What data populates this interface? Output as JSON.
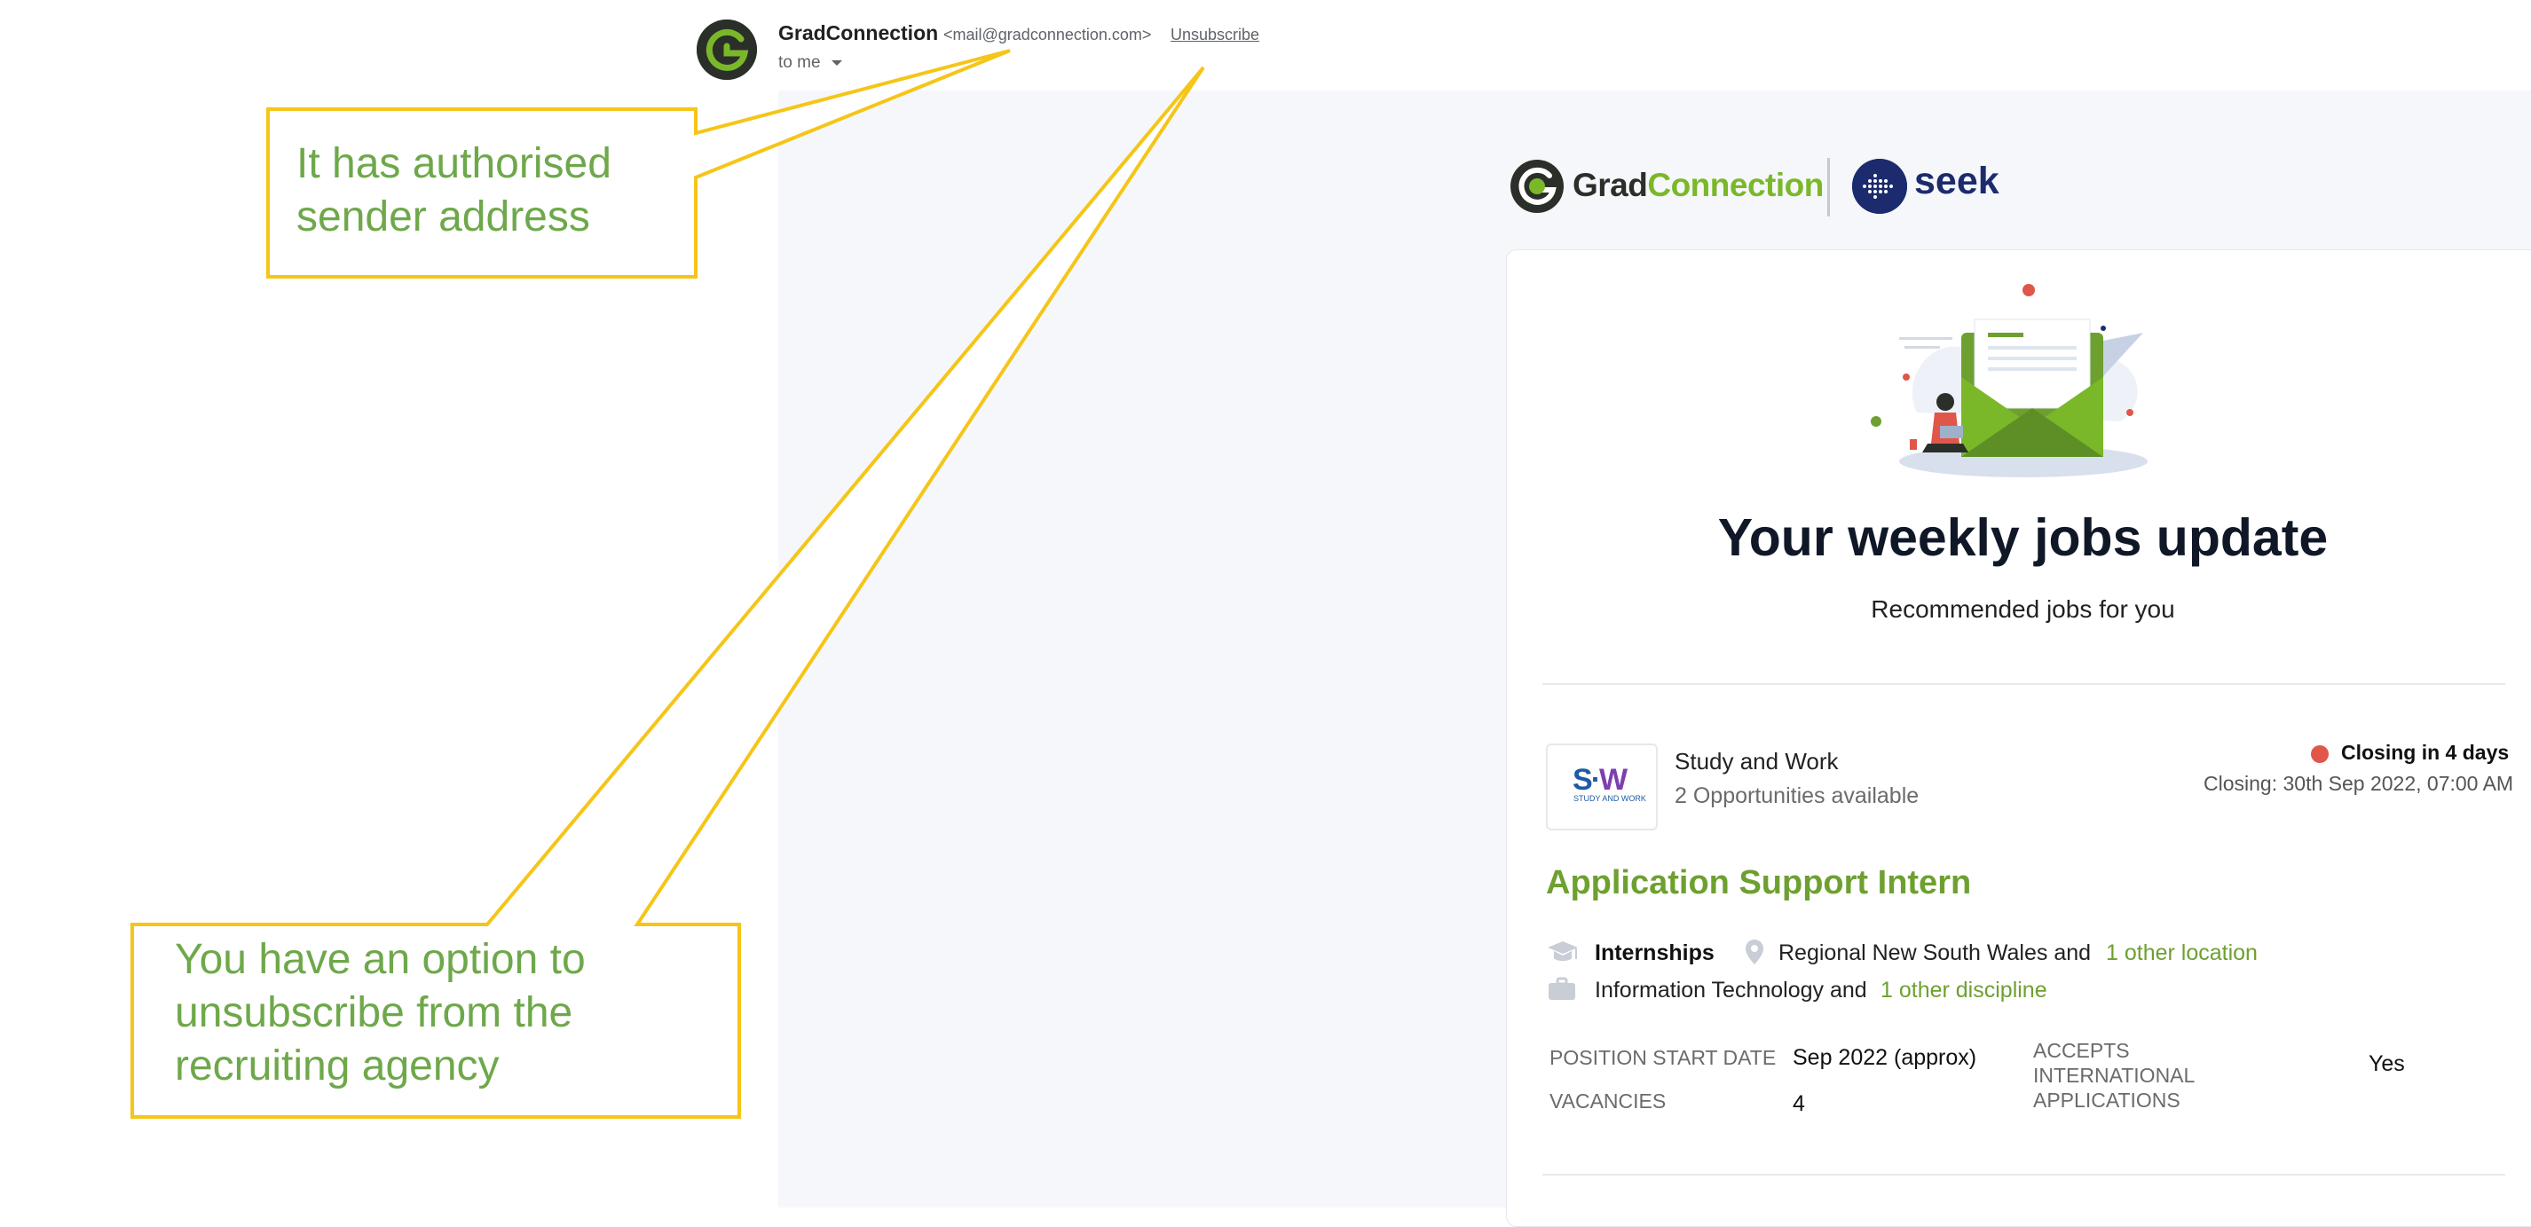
{
  "email_header": {
    "sender_name": "GradConnection",
    "sender_email": "<mail@gradconnection.com>",
    "unsubscribe_label": "Unsubscribe",
    "recipient_label": "to me"
  },
  "brand_header": {
    "gradconnection_logo_part1": "Grad",
    "gradconnection_logo_part2": "Connection",
    "seek_logo": "seek"
  },
  "main": {
    "headline": "Your weekly jobs update",
    "subheadline": "Recommended jobs for you"
  },
  "job_listing": {
    "company_logo_mark_s": "S",
    "company_logo_mark_w": "W",
    "company_logo_subtext": "STUDY AND WORK",
    "company_name": "Study and Work",
    "opportunities": "2 Opportunities available",
    "closing_label": "Closing in 4 days",
    "closing_date": "Closing: 30th Sep 2022, 07:00 AM",
    "title": "Application Support Intern",
    "job_type": "Internships",
    "location": "Regional New South Wales and",
    "location_more": "1 other location",
    "discipline": "Information Technology and",
    "discipline_more": "1 other discipline",
    "details": {
      "start_date_label": "POSITION START DATE",
      "start_date_value": "Sep 2022 (approx)",
      "international_label": "ACCEPTS INTERNATIONAL APPLICATIONS",
      "international_value": "Yes",
      "vacancies_label": "VACANCIES",
      "vacancies_value": "4"
    }
  },
  "annotations": {
    "top": "It has authorised sender address",
    "bottom": "You have an option to unsubscribe from the recruiting agency"
  },
  "colors": {
    "brand_green": "#7ab829",
    "link_green": "#6ea030",
    "annotation_yellow": "#f5c518",
    "annotation_text": "#6ea84a",
    "closing_dot": "#e0574a",
    "seek_navy": "#1c2b6e"
  },
  "icons": [
    "gradconnection-logo-icon",
    "chevron-down-icon",
    "seek-logo-icon",
    "envelope-illustration",
    "graduation-cap-icon",
    "location-pin-icon",
    "briefcase-icon",
    "status-dot-icon"
  ]
}
